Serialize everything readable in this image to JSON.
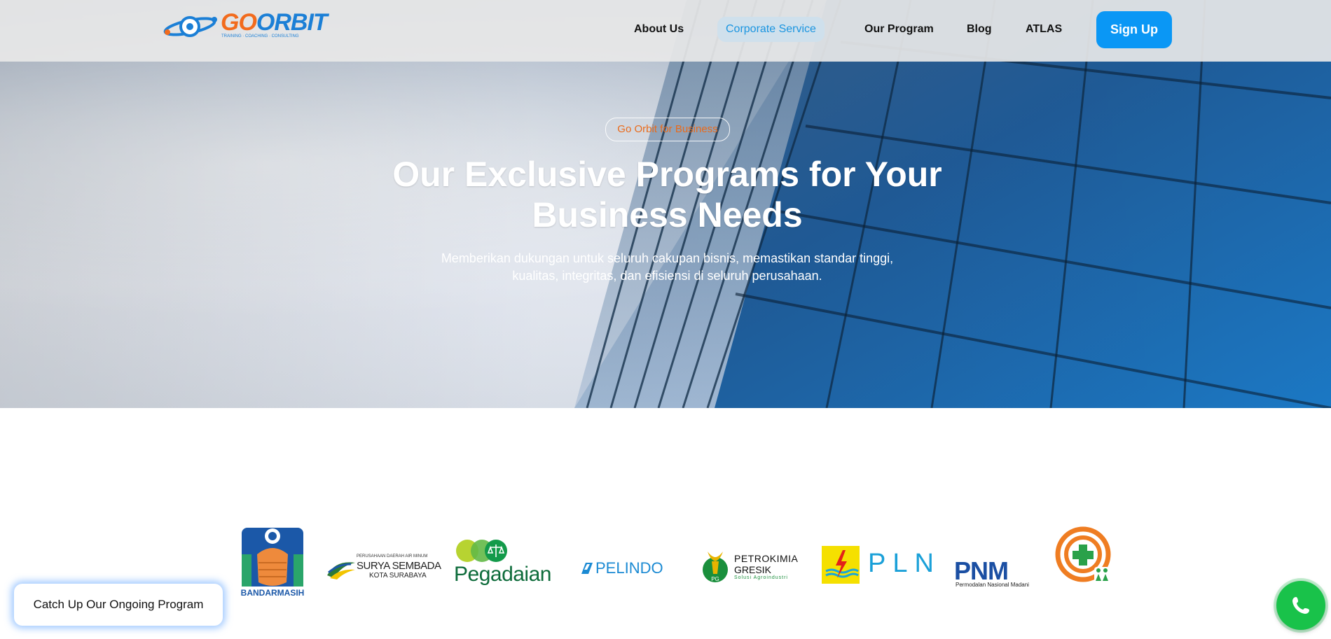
{
  "header": {
    "logo_text_a": "GO",
    "logo_text_b": "ORBIT",
    "logo_tagline": "TRAINING · COACHING · CONSULTING",
    "nav": [
      {
        "label": "About Us"
      },
      {
        "label": "Corporate Service"
      },
      {
        "label": "Our Program"
      },
      {
        "label": "Blog"
      },
      {
        "label": "ATLAS"
      }
    ],
    "signup_label": "Sign Up"
  },
  "hero": {
    "badge": "Go Orbit for Business",
    "title": "Our Exclusive Programs for Your Business Needs",
    "subtitle": "Memberikan dukungan untuk seluruh cakupan bisnis, memastikan standar tinggi, kualitas, integritas, dan efisiensi di seluruh perusahaan."
  },
  "partners": {
    "bandarmasih": "BANDARMASIH",
    "surya_top": "PERUSAHAAN DAERAH AIR MINUM",
    "surya_main": "SURYA SEMBADA",
    "surya_sub": "KOTA SURABAYA",
    "pegadaian": "Pegadaian",
    "pelindo": "PELINDO",
    "petro_1": "PETROKIMIA",
    "petro_2": "GRESIK",
    "petro_3": "Solusi Agroindustri",
    "pln": "PLN",
    "pnm": "PNM",
    "pnm_sub": "Permodalan Nasional Madani"
  },
  "floating": {
    "catchup_label": "Catch Up Our Ongoing Program"
  },
  "colors": {
    "brand_orange": "#f26b1d",
    "brand_blue": "#1b7fd6",
    "signup_blue": "#0a97f5",
    "whatsapp_green": "#19c24a"
  },
  "icons": [
    "orbit-logo-icon",
    "whatsapp-phone-icon"
  ]
}
